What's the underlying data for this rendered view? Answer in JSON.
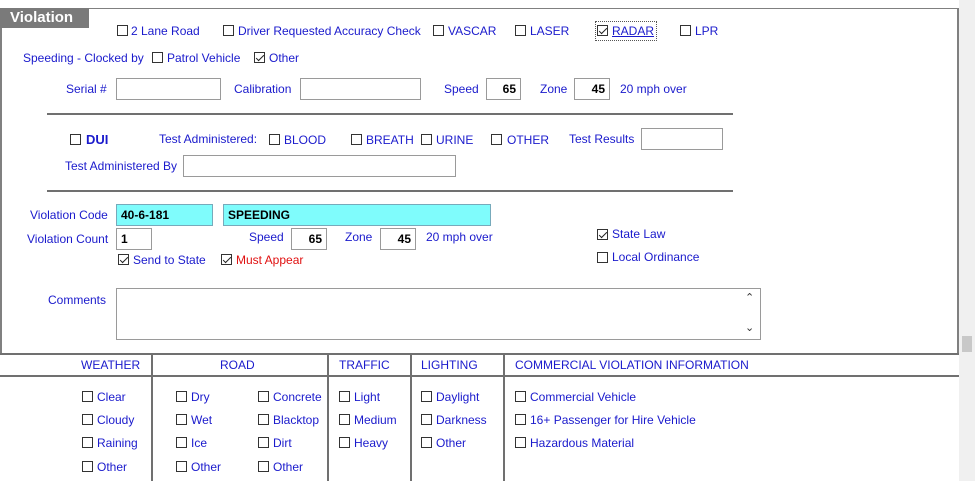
{
  "section": {
    "title": "Violation"
  },
  "top_checks": [
    {
      "label": "2 Lane Road",
      "checked": false
    },
    {
      "label": "Driver Requested Accuracy Check",
      "checked": false
    },
    {
      "label": "VASCAR",
      "checked": false
    },
    {
      "label": "LASER",
      "checked": false
    },
    {
      "label": "RADAR",
      "checked": true
    },
    {
      "label": "LPR",
      "checked": false
    }
  ],
  "speeding": {
    "label": "Speeding - Clocked by",
    "patrol_vehicle": "Patrol Vehicle",
    "other": "Other"
  },
  "serial_row": {
    "serial_label": "Serial #",
    "serial_value": "",
    "calibration_label": "Calibration",
    "calibration_value": "",
    "speed_label": "Speed",
    "speed_value": "65",
    "zone_label": "Zone",
    "zone_value": "45",
    "over_text": "20 mph over"
  },
  "dui": {
    "label": "DUI",
    "test_label": "Test Administered:",
    "blood": "BLOOD",
    "breath": "BREATH",
    "urine": "URINE",
    "other": "OTHER",
    "results_label": "Test Results",
    "results_value": "",
    "admin_by_label": "Test Administered By",
    "admin_by_value": ""
  },
  "violation": {
    "code_label": "Violation Code",
    "code_value": "40-6-181",
    "desc_value": "SPEEDING",
    "count_label": "Violation Count",
    "count_value": "1",
    "speed_label": "Speed",
    "speed_value": "65",
    "zone_label": "Zone",
    "zone_value": "45",
    "over_text": "20 mph over",
    "send_to_state": "Send to State",
    "must_appear": "Must Appear",
    "state_law": "State Law",
    "local_ordinance": "Local Ordinance",
    "comments_label": "Comments",
    "comments_value": ""
  },
  "conditions": {
    "headers": [
      "WEATHER",
      "ROAD",
      "TRAFFIC",
      "LIGHTING",
      "COMMERCIAL VIOLATION INFORMATION"
    ],
    "weather": [
      "Clear",
      "Cloudy",
      "Raining",
      "Other"
    ],
    "road_left": [
      "Dry",
      "Wet",
      "Ice",
      "Other"
    ],
    "road_right": [
      "Concrete",
      "Blacktop",
      "Dirt",
      "Other"
    ],
    "traffic": [
      "Light",
      "Medium",
      "Heavy"
    ],
    "lighting": [
      "Daylight",
      "Darkness",
      "Other"
    ],
    "commercial": [
      "Commercial Vehicle",
      "16+ Passenger for Hire Vehicle",
      "Hazardous Material"
    ]
  },
  "scrollbar_arrows": {
    "up": "⌃",
    "down": "⌄"
  }
}
